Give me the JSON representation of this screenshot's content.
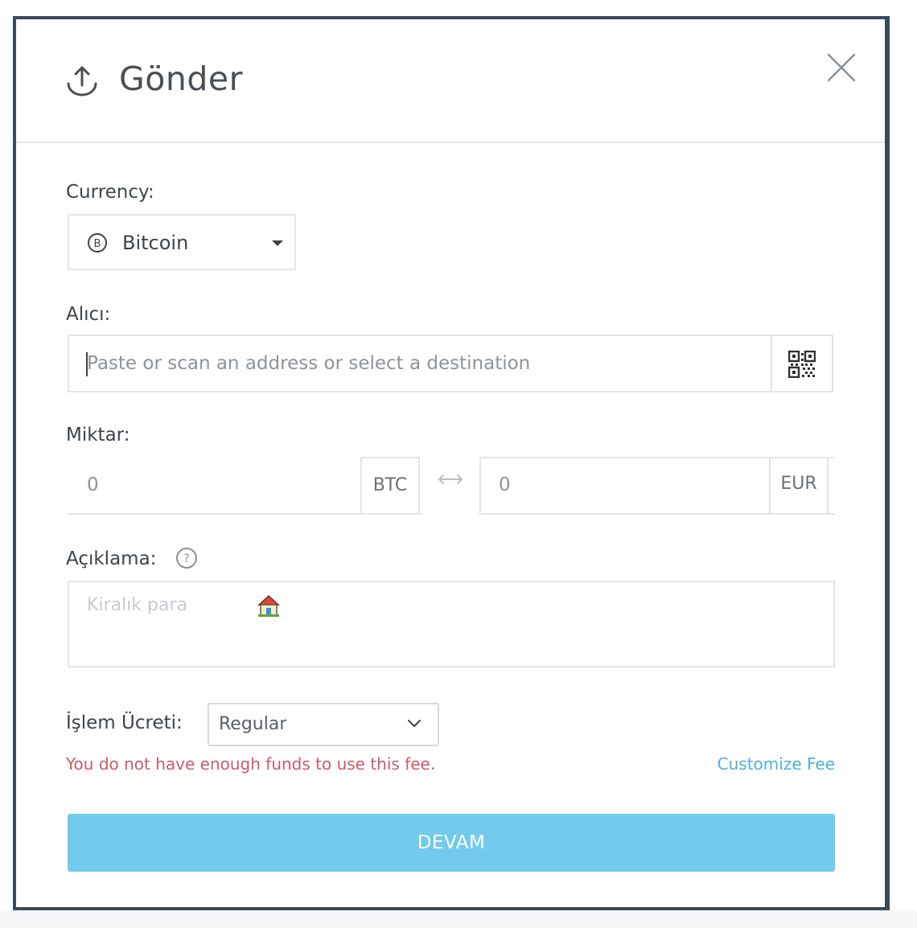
{
  "modal": {
    "title": "Gönder",
    "title_icon": "upload-icon",
    "close_icon": "close-icon"
  },
  "currency": {
    "label": "Currency:",
    "selected": "Bitcoin",
    "icon": "bitcoin-icon"
  },
  "recipient": {
    "label": "Alıcı:",
    "value": "",
    "placeholder": "Paste or scan an address or select a destination",
    "qr_icon": "qr-code-icon"
  },
  "amount": {
    "label": "Miktar:",
    "crypto_value": "0",
    "crypto_unit": "BTC",
    "fiat_value": "0",
    "fiat_unit": "EUR",
    "swap_icon": "swap-arrows-icon"
  },
  "description": {
    "label": "Açıklama:",
    "placeholder": "Kiralık para",
    "help_icon": "question-icon",
    "emoji_icon": "house-icon"
  },
  "fee": {
    "label": "İşlem Ücreti:",
    "selected": "Regular",
    "error": "You do not have enough funds to use this fee.",
    "customize_link": "Customize Fee"
  },
  "actions": {
    "continue_label": "DEVAM"
  },
  "colors": {
    "primary_button": "#72cbec",
    "link": "#4fb0d8",
    "error": "#cc5a6a",
    "text": "#3e434a",
    "border": "#e2e5e8"
  }
}
